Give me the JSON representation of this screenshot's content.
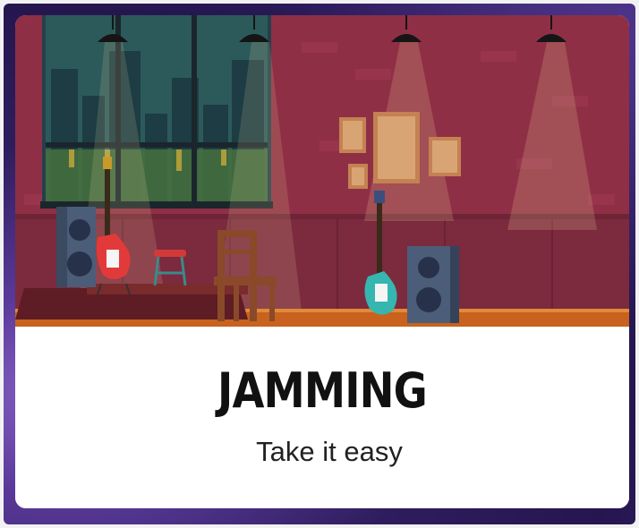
{
  "card": {
    "title": "JAMMING",
    "subtitle": "Take it easy"
  },
  "illustration": {
    "description_icon": "music-stage-illustration",
    "colors": {
      "wall": "#8f2f45",
      "floor": "#c8621e",
      "frame_bg": "#2e1d5e"
    }
  }
}
